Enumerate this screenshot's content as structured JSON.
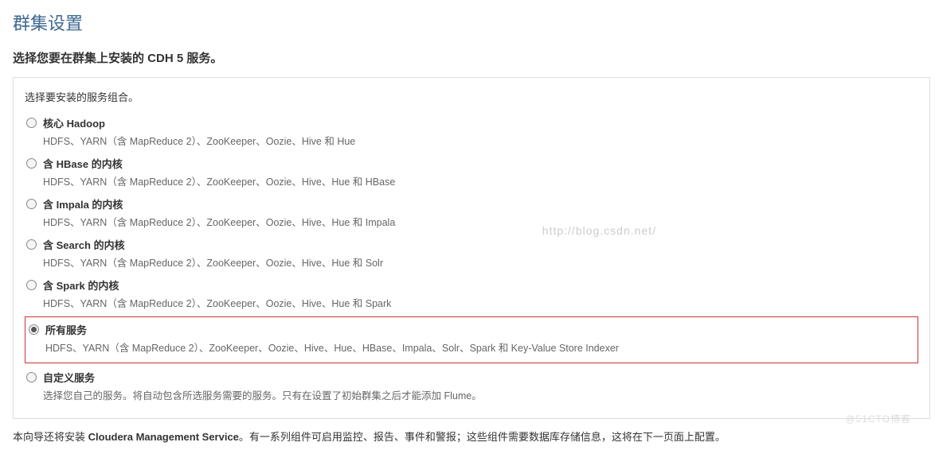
{
  "pageTitle": "群集设置",
  "subtitlePrefix": "选择您要在群集上安装的 ",
  "subtitleBold": "CDH 5",
  "subtitleSuffix": " 服务。",
  "panelIntro": "选择要安装的服务组合。",
  "options": [
    {
      "key": "core-hadoop",
      "title": "核心 Hadoop",
      "desc": "HDFS、YARN（含 MapReduce 2）、ZooKeeper、Oozie、Hive 和 Hue",
      "checked": false
    },
    {
      "key": "with-hbase",
      "title": "含 HBase 的内核",
      "desc": "HDFS、YARN（含 MapReduce 2）、ZooKeeper、Oozie、Hive、Hue 和 HBase",
      "checked": false
    },
    {
      "key": "with-impala",
      "title": "含 Impala 的内核",
      "desc": "HDFS、YARN（含 MapReduce 2）、ZooKeeper、Oozie、Hive、Hue 和 Impala",
      "checked": false
    },
    {
      "key": "with-search",
      "title": "含 Search 的内核",
      "desc": "HDFS、YARN（含 MapReduce 2）、ZooKeeper、Oozie、Hive、Hue 和 Solr",
      "checked": false
    },
    {
      "key": "with-spark",
      "title": "含 Spark 的内核",
      "desc": "HDFS、YARN（含 MapReduce 2）、ZooKeeper、Oozie、Hive、Hue 和 Spark",
      "checked": false
    },
    {
      "key": "all-services",
      "title": "所有服务",
      "desc": "HDFS、YARN（含 MapReduce 2）、ZooKeeper、Oozie、Hive、Hue、HBase、Impala、Solr、Spark 和 Key-Value Store Indexer",
      "checked": true,
      "highlighted": true
    },
    {
      "key": "custom",
      "title": "自定义服务",
      "desc": "选择您自己的服务。将自动包含所选服务需要的服务。只有在设置了初始群集之后才能添加 Flume。",
      "checked": false
    }
  ],
  "footerPrefix": "本向导还将安装 ",
  "footerBold": "Cloudera Management Service",
  "footerSuffix": "。有一系列组件可启用监控、报告、事件和警报；这些组件需要数据库存储信息，这将在下一页面上配置。",
  "watermarkUrl": "http://blog.csdn.net/",
  "watermarkBlog": "@51CTO博客"
}
